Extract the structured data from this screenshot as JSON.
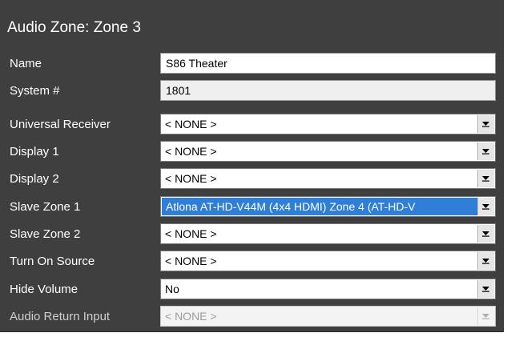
{
  "title": "Audio Zone: Zone 3",
  "fields": [
    {
      "label": "Name",
      "value": "S86 Theater",
      "control": "text"
    },
    {
      "label": "System #",
      "value": "1801",
      "control": "readonly-text"
    },
    {
      "label": "Universal Receiver",
      "value": "< NONE >",
      "control": "select"
    },
    {
      "label": "Display 1",
      "value": "< NONE >",
      "control": "select"
    },
    {
      "label": "Display 2",
      "value": "< NONE >",
      "control": "select"
    },
    {
      "label": "Slave Zone 1",
      "value": "Atlona AT-HD-V44M (4x4 HDMI) Zone 4 (AT-HD-V",
      "control": "select-highlighted"
    },
    {
      "label": "Slave Zone 2",
      "value": "< NONE >",
      "control": "select"
    },
    {
      "label": "Turn On Source",
      "value": "< NONE >",
      "control": "select"
    },
    {
      "label": "Hide Volume",
      "value": "No",
      "control": "select"
    },
    {
      "label": "Audio Return Input",
      "value": "< NONE >",
      "control": "select-disabled"
    }
  ],
  "colors": {
    "panel_background": "#3f3f3f",
    "selection_highlight": "#2f7ed8"
  },
  "icons": {
    "dropdown": "chevron-down-icon"
  }
}
